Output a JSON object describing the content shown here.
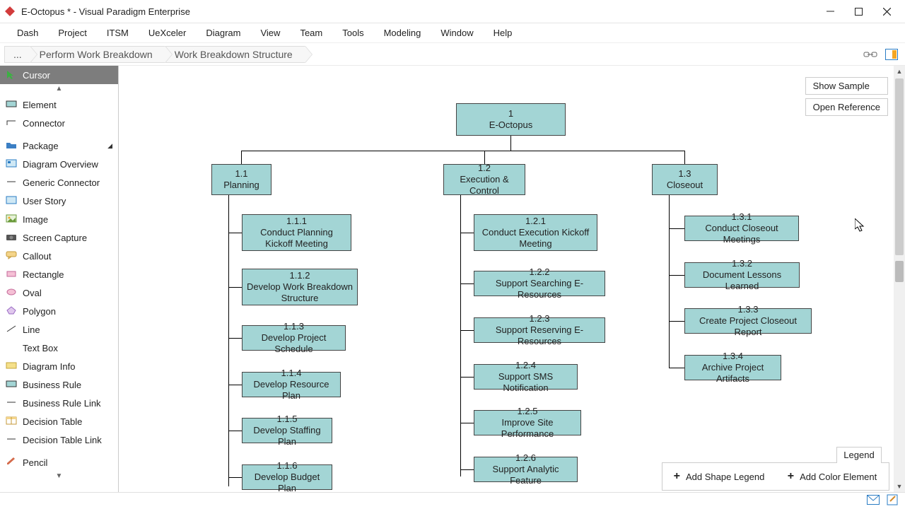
{
  "titlebar": {
    "title": "E-Octopus * - Visual Paradigm Enterprise"
  },
  "menubar": [
    "Dash",
    "Project",
    "ITSM",
    "UeXceler",
    "Diagram",
    "View",
    "Team",
    "Tools",
    "Modeling",
    "Window",
    "Help"
  ],
  "breadcrumb": {
    "root": "...",
    "level1": "Perform Work Breakdown",
    "level2": "Work Breakdown Structure"
  },
  "palette": {
    "cursor": "Cursor",
    "items": [
      "Element",
      "Connector",
      "Package",
      "Diagram Overview",
      "Generic Connector",
      "User Story",
      "Image",
      "Screen Capture",
      "Callout",
      "Rectangle",
      "Oval",
      "Polygon",
      "Line",
      "Text Box",
      "Diagram Info",
      "Business Rule",
      "Business Rule Link",
      "Decision Table",
      "Decision Table Link",
      "Pencil"
    ]
  },
  "float": {
    "sample": "Show Sample",
    "reference": "Open Reference"
  },
  "wbs": {
    "root": {
      "num": "1",
      "label": "E-Octopus"
    },
    "b1": {
      "num": "1.1",
      "label": "Planning"
    },
    "b2": {
      "num": "1.2",
      "label": "Execution & Control"
    },
    "b3": {
      "num": "1.3",
      "label": "Closeout"
    },
    "c11": {
      "num": "1.1.1",
      "label": "Conduct Planning Kickoff Meeting"
    },
    "c12": {
      "num": "1.1.2",
      "label": "Develop Work Breakdown Structure"
    },
    "c13": {
      "num": "1.1.3",
      "label": "Develop Project Schedule"
    },
    "c14": {
      "num": "1.1.4",
      "label": "Develop Resource Plan"
    },
    "c15": {
      "num": "1.1.5",
      "label": "Develop Staffing Plan"
    },
    "c16": {
      "num": "1.1.6",
      "label": "Develop Budget Plan"
    },
    "c21": {
      "num": "1.2.1",
      "label": "Conduct Execution Kickoff Meeting"
    },
    "c22": {
      "num": "1.2.2",
      "label": "Support Searching E-Resources"
    },
    "c23": {
      "num": "1.2.3",
      "label": "Support Reserving E-Resources"
    },
    "c24": {
      "num": "1.2.4",
      "label": "Support SMS Notification"
    },
    "c25": {
      "num": "1.2.5",
      "label": "Improve Site Performance"
    },
    "c26": {
      "num": "1.2.6",
      "label": "Support Analytic Feature"
    },
    "c31": {
      "num": "1.3.1",
      "label": "Conduct Closeout Meetings"
    },
    "c32": {
      "num": "1.3.2",
      "label": "Document Lessons Learned"
    },
    "c33": {
      "num": "1.3.3",
      "label": "Create Project Closeout Report"
    },
    "c34": {
      "num": "1.3.4",
      "label": "Archive Project Artifacts"
    }
  },
  "legend": {
    "tab": "Legend",
    "shape": "Add Shape Legend",
    "color": "Add Color Element"
  },
  "chart_data": {
    "type": "tree",
    "title": "Work Breakdown Structure",
    "root": {
      "id": "1",
      "name": "E-Octopus",
      "children": [
        {
          "id": "1.1",
          "name": "Planning",
          "children": [
            {
              "id": "1.1.1",
              "name": "Conduct Planning Kickoff Meeting"
            },
            {
              "id": "1.1.2",
              "name": "Develop Work Breakdown Structure"
            },
            {
              "id": "1.1.3",
              "name": "Develop Project Schedule"
            },
            {
              "id": "1.1.4",
              "name": "Develop Resource Plan"
            },
            {
              "id": "1.1.5",
              "name": "Develop Staffing Plan"
            },
            {
              "id": "1.1.6",
              "name": "Develop Budget Plan"
            }
          ]
        },
        {
          "id": "1.2",
          "name": "Execution & Control",
          "children": [
            {
              "id": "1.2.1",
              "name": "Conduct Execution Kickoff Meeting"
            },
            {
              "id": "1.2.2",
              "name": "Support Searching E-Resources"
            },
            {
              "id": "1.2.3",
              "name": "Support Reserving E-Resources"
            },
            {
              "id": "1.2.4",
              "name": "Support SMS Notification"
            },
            {
              "id": "1.2.5",
              "name": "Improve Site Performance"
            },
            {
              "id": "1.2.6",
              "name": "Support Analytic Feature"
            }
          ]
        },
        {
          "id": "1.3",
          "name": "Closeout",
          "children": [
            {
              "id": "1.3.1",
              "name": "Conduct Closeout Meetings"
            },
            {
              "id": "1.3.2",
              "name": "Document Lessons Learned"
            },
            {
              "id": "1.3.3",
              "name": "Create Project Closeout Report"
            },
            {
              "id": "1.3.4",
              "name": "Archive Project Artifacts"
            }
          ]
        }
      ]
    }
  }
}
